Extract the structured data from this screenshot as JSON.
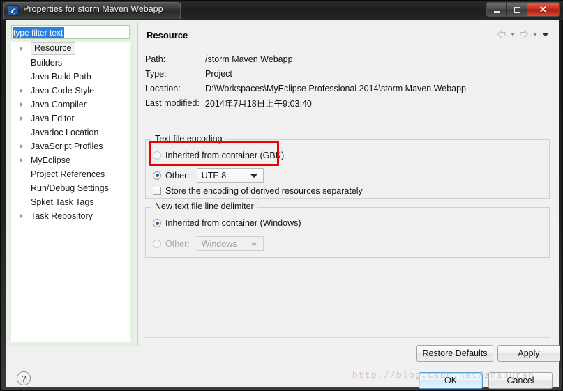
{
  "window": {
    "title": "Properties for storm Maven Webapp",
    "app_icon": "eclipse-properties-icon",
    "buttons": {
      "minimize": "minimize-button",
      "maximize": "maximize-button",
      "close_label": "✕"
    }
  },
  "sidebar": {
    "filter": {
      "value": "type filter text",
      "placeholder": "type filter text"
    },
    "items": [
      {
        "label": "Resource",
        "expandable": true,
        "selected": true
      },
      {
        "label": "Builders",
        "expandable": false,
        "selected": false
      },
      {
        "label": "Java Build Path",
        "expandable": false,
        "selected": false
      },
      {
        "label": "Java Code Style",
        "expandable": true,
        "selected": false
      },
      {
        "label": "Java Compiler",
        "expandable": true,
        "selected": false
      },
      {
        "label": "Java Editor",
        "expandable": true,
        "selected": false
      },
      {
        "label": "Javadoc Location",
        "expandable": false,
        "selected": false
      },
      {
        "label": "JavaScript Profiles",
        "expandable": true,
        "selected": false
      },
      {
        "label": "MyEclipse",
        "expandable": true,
        "selected": false
      },
      {
        "label": "Project References",
        "expandable": false,
        "selected": false
      },
      {
        "label": "Run/Debug Settings",
        "expandable": false,
        "selected": false
      },
      {
        "label": "Spket Task Tags",
        "expandable": false,
        "selected": false
      },
      {
        "label": "Task Repository",
        "expandable": true,
        "selected": false
      }
    ]
  },
  "page": {
    "title": "Resource",
    "nav": {
      "back": "back-arrow-icon",
      "back_menu": "back-dropdown-icon",
      "forward": "forward-arrow-icon",
      "forward_menu": "forward-dropdown-icon",
      "menu": "view-menu-icon"
    },
    "info": [
      {
        "label": "Path:",
        "value": "/storm Maven Webapp"
      },
      {
        "label": "Type:",
        "value": "Project"
      },
      {
        "label": "Location:",
        "value": "D:\\Workspaces\\MyEclipse Professional 2014\\storm Maven Webapp"
      },
      {
        "label": "Last modified:",
        "value": "2014年7月18日上午9:03:40"
      }
    ],
    "text_file_encoding": {
      "group_title": "Text file encoding",
      "inherited_label": "Inherited from container (GBK)",
      "inherited_checked": false,
      "other_label": "Other:",
      "other_checked": true,
      "other_value": "UTF-8",
      "store_derived_label": "Store the encoding of derived resources separately",
      "store_derived_checked": false
    },
    "line_delimiter": {
      "group_title": "New text file line delimiter",
      "inherited_label": "Inherited from container (Windows)",
      "inherited_checked": true,
      "other_label": "Other:",
      "other_checked": false,
      "other_value": "Windows"
    },
    "buttons": {
      "restore_defaults": "Restore Defaults",
      "apply": "Apply"
    }
  },
  "footer": {
    "help": "?",
    "ok": "OK",
    "cancel": "Cancel"
  },
  "watermark": {
    "text": "http://blog.csdn.net/zhshuran"
  },
  "colors": {
    "accent_blue": "#2a7fe0",
    "annotation_red": "#ef0000",
    "filter_panel_green": "#e3f0e2",
    "dialog_grey": "#f0f0f0",
    "close_red": "#c62b16"
  }
}
